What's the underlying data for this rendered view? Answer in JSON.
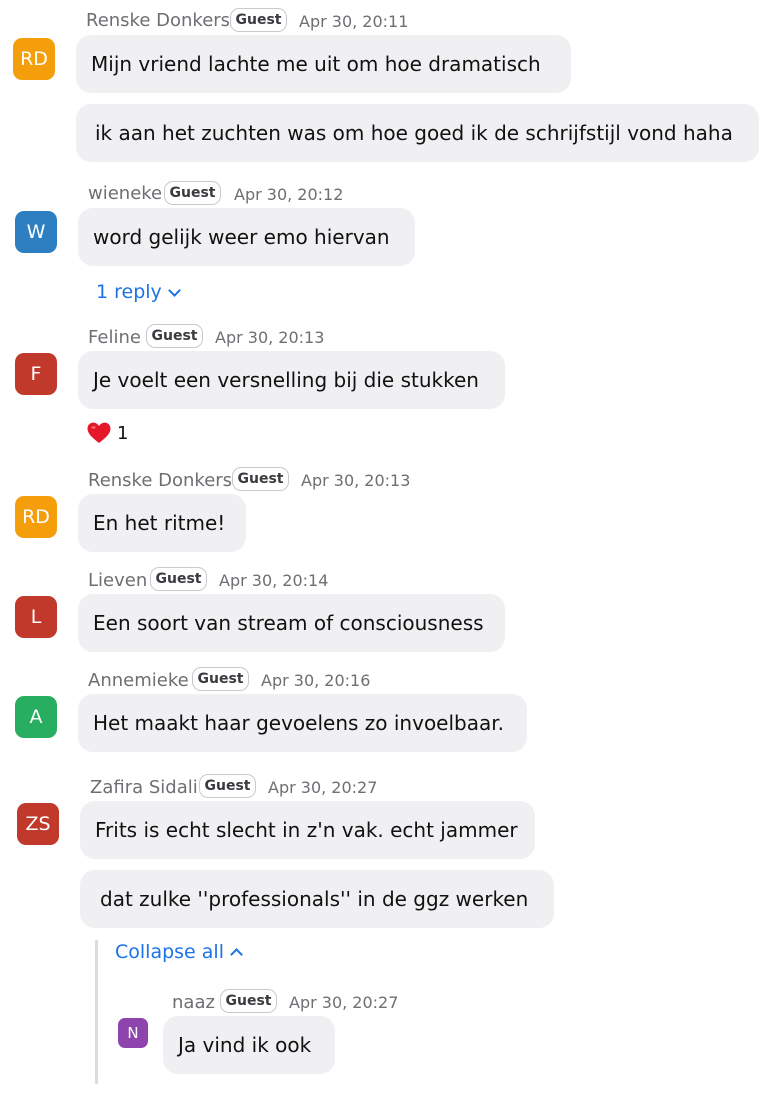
{
  "messages": [
    {
      "author": "Renske Donkers",
      "initials": "RD",
      "avatar_color": "#f59e0b",
      "badge": "Guest",
      "time": "Apr 30, 20:11",
      "bubbles": [
        "Mijn vriend lachte me uit om hoe dramatisch",
        "ik aan het zuchten was om hoe goed ik de schrijfstijl vond haha"
      ]
    },
    {
      "author": "wieneke",
      "initials": "W",
      "avatar_color": "#2d7fc1",
      "badge": "Guest",
      "time": "Apr 30, 20:12",
      "bubbles": [
        "word gelijk weer emo hiervan"
      ],
      "reply_link": "1 reply"
    },
    {
      "author": "Feline",
      "initials": "F",
      "avatar_color": "#c0392b",
      "badge": "Guest",
      "time": "Apr 30, 20:13",
      "bubbles": [
        "Je voelt een versnelling bij die stukken"
      ],
      "reaction": {
        "icon": "heart-icon",
        "count": "1"
      }
    },
    {
      "author": "Renske Donkers",
      "initials": "RD",
      "avatar_color": "#f59e0b",
      "badge": "Guest",
      "time": "Apr 30, 20:13",
      "bubbles": [
        "En het ritme!"
      ]
    },
    {
      "author": "Lieven",
      "initials": "L",
      "avatar_color": "#c0392b",
      "badge": "Guest",
      "time": "Apr 30, 20:14",
      "bubbles": [
        "Een soort van stream of consciousness"
      ]
    },
    {
      "author": "Annemieke",
      "initials": "A",
      "avatar_color": "#27ae60",
      "badge": "Guest",
      "time": "Apr 30, 20:16",
      "bubbles": [
        "Het maakt haar gevoelens zo invoelbaar."
      ]
    },
    {
      "author": "Zafira Sidali",
      "initials": "ZS",
      "avatar_color": "#c0392b",
      "badge": "Guest",
      "time": "Apr 30, 20:27",
      "bubbles": [
        "Frits is echt slecht in z'n vak. echt jammer",
        "dat zulke ''professionals'' in de ggz werken"
      ],
      "collapse_link": "Collapse all"
    }
  ],
  "thread_reply": {
    "author": "naaz",
    "initials": "N",
    "avatar_color": "#8e44ad",
    "badge": "Guest",
    "time": "Apr 30, 20:27",
    "bubble": "Ja vind ik ook"
  }
}
